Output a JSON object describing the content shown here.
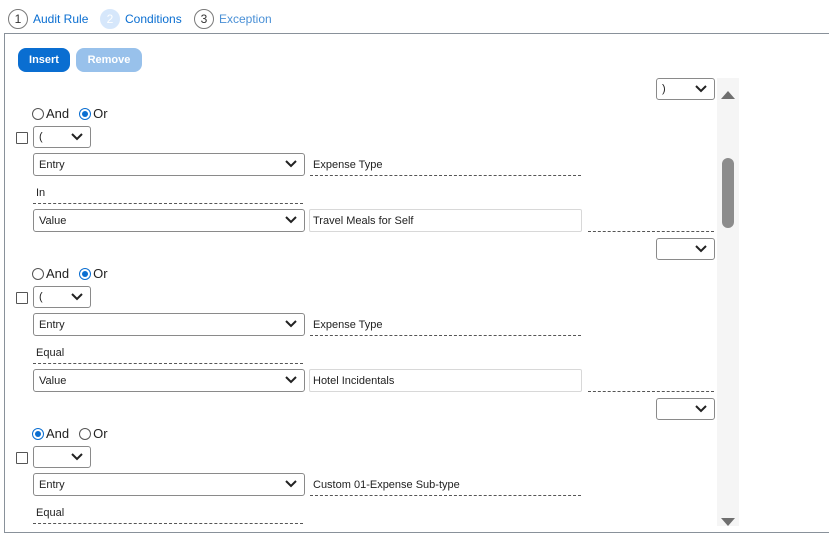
{
  "wizard": {
    "steps": [
      {
        "num": "1",
        "label": "Audit Rule"
      },
      {
        "num": "2",
        "label": "Conditions"
      },
      {
        "num": "3",
        "label": "Exception"
      }
    ]
  },
  "toolbar": {
    "insert_label": "Insert",
    "remove_label": "Remove"
  },
  "top_close_paren": ")",
  "radio_labels": {
    "and": "And",
    "or": "Or"
  },
  "conditions": [
    {
      "selected": "Or",
      "open_paren": "(",
      "left_type": "Entry",
      "left_field": "Expense Type",
      "operator": "In",
      "right_type": "Value",
      "right_value": "Travel Meals for Self",
      "close_paren": ""
    },
    {
      "selected": "Or",
      "open_paren": "(",
      "left_type": "Entry",
      "left_field": "Expense Type",
      "operator": "Equal",
      "right_type": "Value",
      "right_value": "Hotel Incidentals",
      "close_paren": ""
    },
    {
      "selected": "And",
      "open_paren": "",
      "left_type": "Entry",
      "left_field": "Custom 01-Expense Sub-type",
      "operator": "Equal"
    }
  ]
}
